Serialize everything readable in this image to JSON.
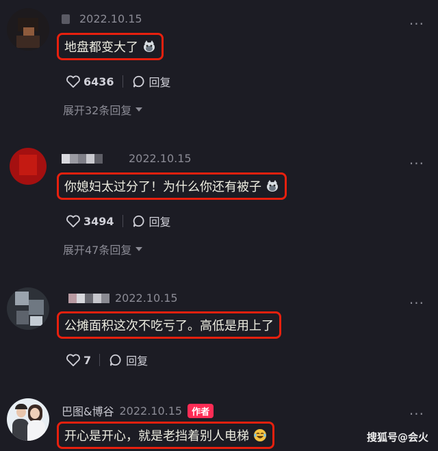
{
  "comments": [
    {
      "date": "2022.10.15",
      "text": "地盘都变大了",
      "likes": "6436",
      "reply_label": "回复",
      "expand": "展开32条回复"
    },
    {
      "date": "2022.10.15",
      "text": "你媳妇太过分了！为什么你还有被子",
      "likes": "3494",
      "reply_label": "回复",
      "expand": "展开47条回复"
    },
    {
      "date": "2022.10.15",
      "text": "公摊面积这次不吃亏了。高低是用上了",
      "likes": "7",
      "reply_label": "回复"
    },
    {
      "name": "巴图&博谷",
      "date": "2022.10.15",
      "badge": "作者",
      "text": "开心是开心，就是老挡着别人电梯"
    }
  ],
  "more_label": "···",
  "watermark": "搜狐号@会火",
  "colors": {
    "background": "#1c1c24",
    "highlight_border": "#e8200e",
    "author_badge": "#fe2c55",
    "muted_text": "#8b8b95"
  },
  "icons": [
    "heart-icon",
    "reply-bubble-icon",
    "more-dots-icon",
    "cat-emoji-icon",
    "laughing-emoji-icon",
    "chevron-down-icon"
  ]
}
